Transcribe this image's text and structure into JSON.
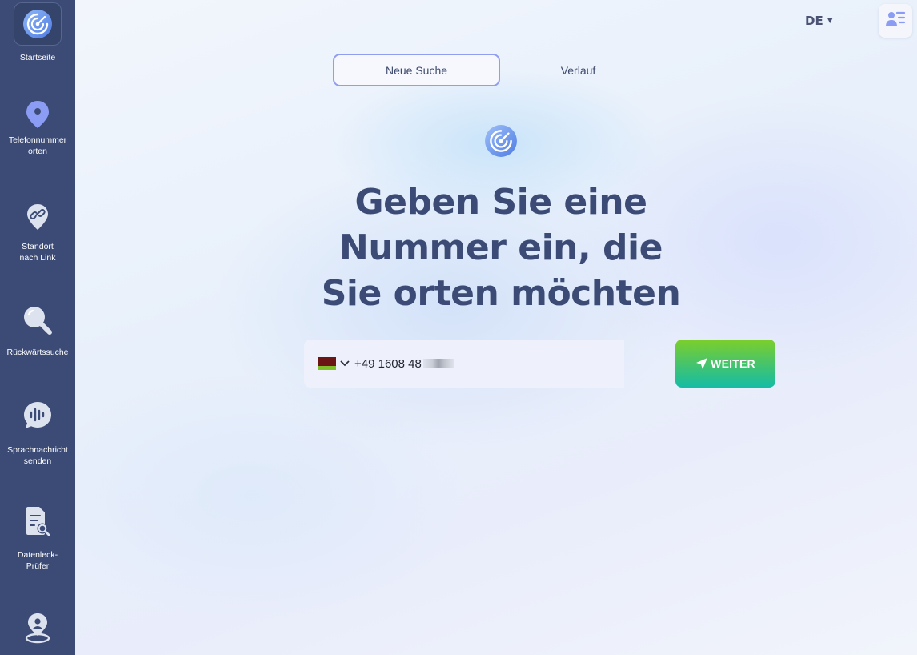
{
  "sidebar": {
    "items": [
      {
        "label": "Startseite",
        "icon": "radar-logo-icon",
        "active": true
      },
      {
        "label": "Telefonnummer\norten",
        "icon": "location-pin-icon"
      },
      {
        "label": "Standort\nnach Link",
        "icon": "link-pin-icon"
      },
      {
        "label": "Rückwärtssuche",
        "icon": "magnifier-icon"
      },
      {
        "label": "Sprachnachricht\nsenden",
        "icon": "voice-message-icon"
      },
      {
        "label": "Datenleck-\nPrüfer",
        "icon": "document-search-icon"
      },
      {
        "label": "",
        "icon": "person-pin-icon"
      }
    ]
  },
  "header": {
    "language": "DE",
    "account_icon": "user-list-icon"
  },
  "tabs": [
    {
      "label": "Neue Suche",
      "active": true
    },
    {
      "label": "Verlauf",
      "active": false
    }
  ],
  "headline": {
    "line1": "Geben Sie eine",
    "line2": "Nummer ein, die",
    "line3": "Sie orten möchten"
  },
  "search": {
    "flag_icon": "flag-icon",
    "phone_value": "+49 1608 48",
    "phone_value_obscured": true,
    "submit_label": "WEITER",
    "submit_icon": "send-arrow-icon"
  },
  "colors": {
    "sidebar_bg": "#3c4b75",
    "headline": "#3c4b75",
    "active_tab_border": "#8f9ef0",
    "button_gradient_top": "#7ccf2a",
    "button_gradient_bottom": "#14bda6",
    "icon_accent": "#8b9cf4"
  }
}
